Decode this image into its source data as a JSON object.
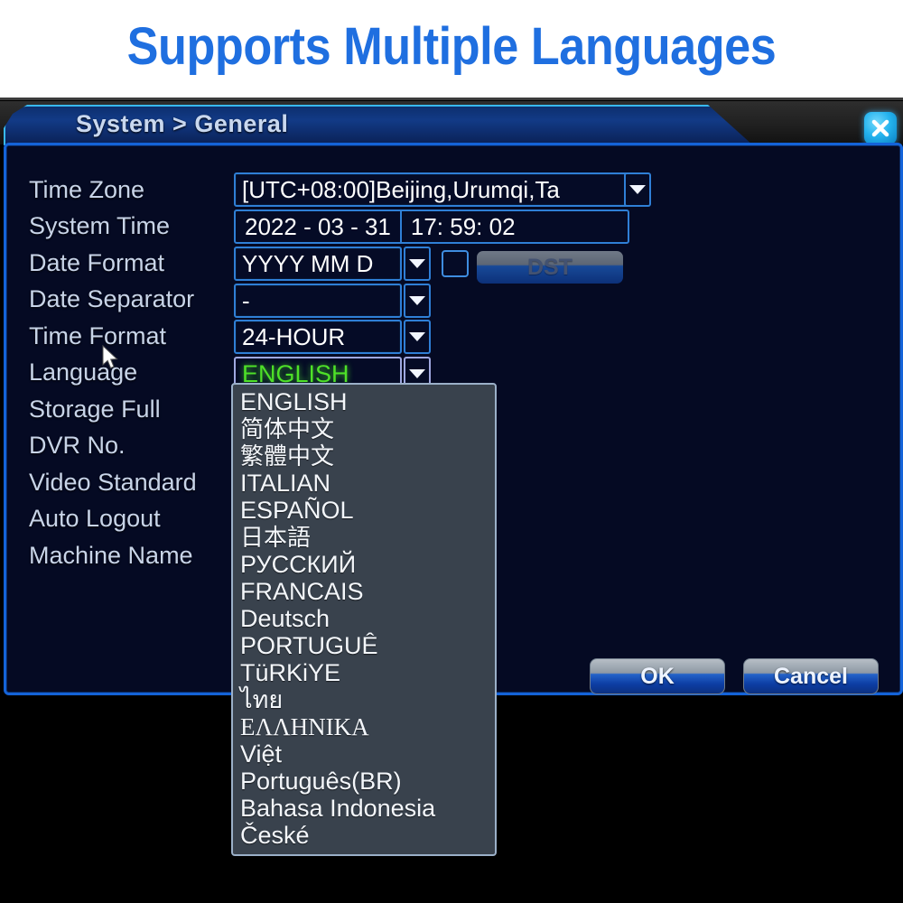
{
  "banner": {
    "title": "Supports Multiple Languages",
    "color": "#1f6fe0"
  },
  "dialog": {
    "title": "System > General",
    "close_icon": "close-icon"
  },
  "form": {
    "rows": [
      {
        "label": "Time Zone",
        "value": "[UTC+08:00]Beijing,Urumqi,Ta"
      },
      {
        "label": "System Time",
        "date": "2022 - 03 - 31",
        "time": "17: 59: 02"
      },
      {
        "label": "Date Format",
        "value": "YYYY MM D",
        "dst_label": "DST",
        "dst_checked": false
      },
      {
        "label": "Date Separator",
        "value": "-"
      },
      {
        "label": "Time Format",
        "value": "24-HOUR"
      },
      {
        "label": "Language",
        "value": "ENGLISH",
        "value_color": "#4ee028"
      },
      {
        "label": "Storage Full"
      },
      {
        "label": "DVR No."
      },
      {
        "label": "Video Standard"
      },
      {
        "label": "Auto Logout"
      },
      {
        "label": "Machine Name"
      }
    ]
  },
  "language_dropdown": {
    "open": true,
    "selected": "ENGLISH",
    "options": [
      "ENGLISH",
      "简体中文",
      "繁體中文",
      "ITALIAN",
      "ESPAÑOL",
      "日本語",
      "РУССКИЙ",
      "FRANCAIS",
      "Deutsch",
      "PORTUGUÊ",
      "TüRKiYE",
      "ไทย",
      "ΕΛΛΗΝΙΚΑ",
      "Việt",
      "Português(BR)",
      "Bahasa Indonesia",
      "České"
    ]
  },
  "buttons": {
    "ok": "OK",
    "cancel": "Cancel"
  }
}
